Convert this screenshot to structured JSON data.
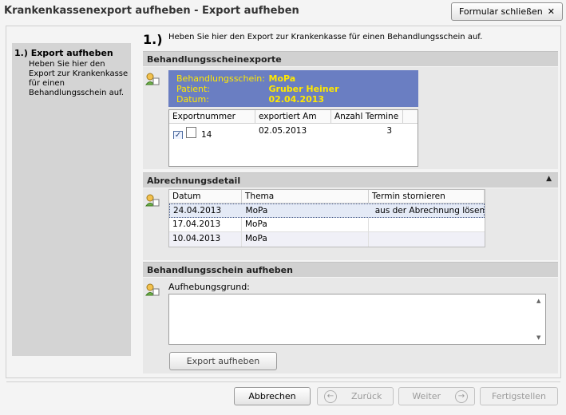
{
  "window": {
    "title": "Krankenkassenexport aufheben - Export aufheben",
    "close_label": "Formular schließen"
  },
  "sidebar": {
    "title": "1.) Export aufheben",
    "description": "Heben Sie hier den Export zur Krankenkasse für einen Behandlungsschein auf."
  },
  "step": {
    "number": "1.)",
    "description": "Heben Sie hier den Export zur Krankenkasse für einen Behandlungsschein auf."
  },
  "exports_section": {
    "header": "Behandlungsscheinexporte",
    "info": {
      "schein_label": "Behandlungsschein:",
      "schein_value": "MoPa",
      "patient_label": "Patient:",
      "patient_value": "Gruber Heiner",
      "datum_label": "Datum:",
      "datum_value": "02.04.2013"
    },
    "table": {
      "columns": [
        "Exportnummer",
        "exportiert Am",
        "Anzahl Termine"
      ],
      "rows": [
        {
          "checked": true,
          "nummer": "14",
          "exportiert": "02.05.2013",
          "termine": "3"
        }
      ]
    }
  },
  "detail_section": {
    "header": "Abrechnungsdetail",
    "table": {
      "columns": [
        "Datum",
        "Thema",
        "Termin stornieren"
      ],
      "rows": [
        {
          "datum": "24.04.2013",
          "thema": "MoPa",
          "action": "aus der Abrechnung lösen"
        },
        {
          "datum": "17.04.2013",
          "thema": "MoPa",
          "action": ""
        },
        {
          "datum": "10.04.2013",
          "thema": "MoPa",
          "action": ""
        }
      ]
    }
  },
  "cancel_section": {
    "header": "Behandlungsschein aufheben",
    "reason_label": "Aufhebungsgrund:",
    "reason_value": "",
    "submit_label": "Export aufheben"
  },
  "footer": {
    "abbrechen": "Abbrechen",
    "zurueck": "Zurück",
    "weiter": "Weiter",
    "fertigstellen": "Fertigstellen"
  }
}
